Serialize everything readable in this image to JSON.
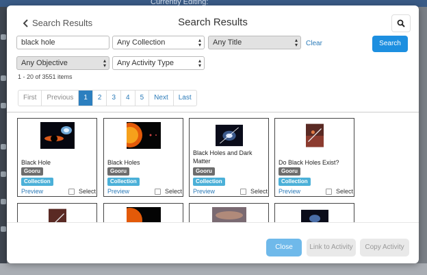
{
  "background": {
    "editing_label": "Currently Editing:"
  },
  "header": {
    "back_label": "Search Results",
    "title": "Search Results",
    "search_icon": "search-icon"
  },
  "filters": {
    "query": "black hole",
    "collection": "Any Collection",
    "title_filter": "Any Title",
    "objective": "Any Objective",
    "activity_type": "Any Activity Type",
    "clear_label": "Clear",
    "search_label": "Search"
  },
  "results": {
    "count_text": "1 - 20 of 3551 items"
  },
  "pagination": {
    "first": "First",
    "previous": "Previous",
    "pages": [
      "1",
      "2",
      "3",
      "4",
      "5"
    ],
    "active_page": "1",
    "next": "Next",
    "last": "Last"
  },
  "cards": [
    {
      "title": "Black Hole",
      "source": "Gooru",
      "type": "Collection",
      "preview": "Preview",
      "select": "Select"
    },
    {
      "title": "Black Holes",
      "source": "Gooru",
      "type": "Collection",
      "preview": "Preview",
      "select": "Select"
    },
    {
      "title": "Black Holes and Dark Matter",
      "source": "Gooru",
      "type": "Collection",
      "preview": "Preview",
      "select": "Select"
    },
    {
      "title": "Do Black Holes Exist?",
      "source": "Gooru",
      "type": "Collection",
      "preview": "Preview",
      "select": "Select"
    }
  ],
  "footer": {
    "close": "Close",
    "link": "Link to Activity",
    "copy": "Copy Activity"
  },
  "colors": {
    "primary": "#1d8fe0",
    "active_page": "#2c7fbf",
    "badge_gooru": "#6d6d6d",
    "badge_collection": "#4bb0d8"
  }
}
